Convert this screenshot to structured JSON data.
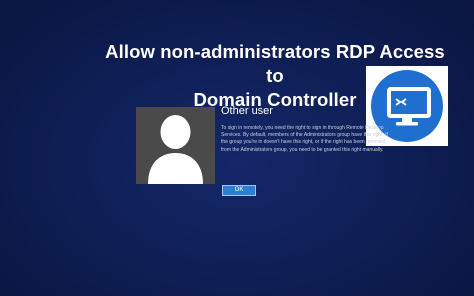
{
  "headline": {
    "line1": "Allow non-administrators RDP Access to",
    "line2": "Domain Controller"
  },
  "badge": {
    "icon": "remote-desktop-icon",
    "circle_color": "#1f6fd1"
  },
  "login": {
    "avatar_icon": "user-silhouette-icon",
    "user_name": "Other user",
    "message": "To sign in remotely, you need the right to sign in through Remote Desktop Services. By default, members of the Administrators group have this right. If the group you're in doesn't have this right, or if the right has been removed from the Administrators group, you need to be granted this right manually.",
    "ok_label": "OK"
  },
  "colors": {
    "background": "#0e1d52",
    "button": "#2e7dd6"
  }
}
